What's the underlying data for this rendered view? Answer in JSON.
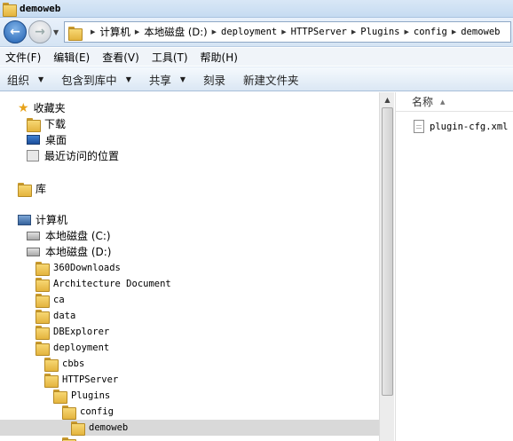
{
  "window": {
    "title": "demoweb"
  },
  "address": {
    "crumbs": [
      "计算机",
      "本地磁盘 (D:)",
      "deployment",
      "HTTPServer",
      "Plugins",
      "config",
      "demoweb"
    ]
  },
  "menu": [
    "文件(F)",
    "编辑(E)",
    "查看(V)",
    "工具(T)",
    "帮助(H)"
  ],
  "toolbar": {
    "organize": "组织",
    "include_in_library": "包含到库中",
    "share": "共享",
    "burn": "刻录",
    "new_folder": "新建文件夹"
  },
  "nav": {
    "favorites": "收藏夹",
    "downloads": "下载",
    "desktop": "桌面",
    "recent": "最近访问的位置",
    "libraries": "库",
    "computer": "计算机",
    "drive_c": "本地磁盘 (C:)",
    "drive_d": "本地磁盘 (D:)",
    "folders": [
      "360Downloads",
      "Architecture Document",
      "ca",
      "data",
      "DBExplorer",
      "deployment",
      "cbbs",
      "HTTPServer",
      "Plugins",
      "config",
      "demoweb"
    ]
  },
  "filelist": {
    "column_name": "名称",
    "files": [
      "plugin-cfg.xml"
    ]
  },
  "colors": {
    "selection": "#d9d9d9",
    "folder": "#f7d774",
    "titlebar": "#d9e7f6"
  }
}
